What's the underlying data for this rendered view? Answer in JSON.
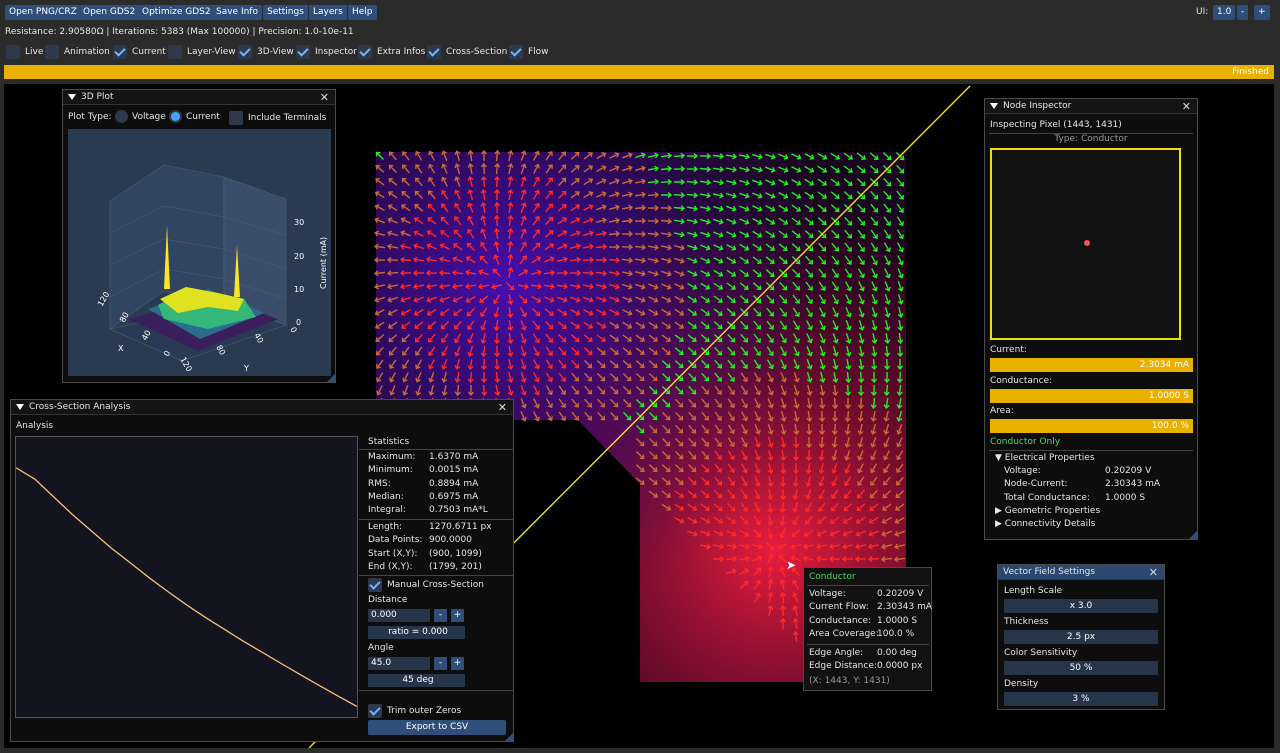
{
  "toolbar": {
    "buttons": [
      "Open PNG/CRZ",
      "Open GDS2",
      "Optimize GDS2",
      "Save Info",
      "Settings",
      "Layers",
      "Help"
    ],
    "ui_label": "UI:",
    "ui_scale": "1.0",
    "minus": "-",
    "plus": "+"
  },
  "status_line": "Resistance: 2.90580Ω | Iterations: 5383 (Max 100000) | Precision: 1.0-10e-11",
  "toggles": [
    {
      "label": "Live",
      "checked": false
    },
    {
      "label": "Animation",
      "checked": false
    },
    {
      "label": "Current",
      "checked": true
    },
    {
      "label": "Layer-View",
      "checked": false
    },
    {
      "label": "3D-View",
      "checked": true
    },
    {
      "label": "Inspector",
      "checked": true
    },
    {
      "label": "Extra Infos",
      "checked": true
    },
    {
      "label": "Cross-Section",
      "checked": true
    },
    {
      "label": "Flow",
      "checked": true
    }
  ],
  "progress": {
    "label": "Finished",
    "fraction": 1.0,
    "color": "#e8b000"
  },
  "plot3d": {
    "title": "3D Plot",
    "plot_type_label": "Plot Type:",
    "options": [
      {
        "label": "Voltage",
        "selected": false
      },
      {
        "label": "Current",
        "selected": true
      }
    ],
    "include_terminals": "Include Terminals",
    "z_ticks": [
      "30",
      "20",
      "10",
      "0"
    ],
    "z_label": "Current (mA)",
    "x_ticks": [
      "120",
      "80",
      "40",
      "0"
    ],
    "x_label": "X",
    "y_ticks": [
      "0",
      "40",
      "80",
      "120"
    ],
    "y_label": "Y"
  },
  "cross": {
    "title": "Cross-Section Analysis",
    "section": "Analysis",
    "stats_title": "Statistics",
    "stats": [
      [
        "Maximum:",
        "1.6370 mA"
      ],
      [
        "Minimum:",
        "0.0015 mA"
      ],
      [
        "RMS:",
        "0.8894 mA"
      ],
      [
        "Median:",
        "0.6975 mA"
      ],
      [
        "Integral:",
        "0.7503 mA*L"
      ]
    ],
    "geo": [
      [
        "Length:",
        "1270.6711 px"
      ],
      [
        "Data Points:",
        "900.0000"
      ],
      [
        "Start (X,Y):",
        "(900, 1099)"
      ],
      [
        "End (X,Y):",
        "(1799, 201)"
      ]
    ],
    "manual": "Manual Cross-Section",
    "distance_label": "Distance",
    "distance": "0.000",
    "ratio": "ratio = 0.000",
    "angle_label": "Angle",
    "angle": "45.0",
    "angle_deg": "45 deg",
    "trim": "Trim outer Zeros",
    "export": "Export to CSV",
    "minus": "-",
    "plus": "+",
    "curve": [
      1.637,
      1.56,
      1.44,
      1.32,
      1.21,
      1.1,
      1.0,
      0.9,
      0.805,
      0.715,
      0.63,
      0.55,
      0.47,
      0.395,
      0.32,
      0.245,
      0.172,
      0.1,
      0.03
    ]
  },
  "inspector": {
    "title": "Node Inspector",
    "pixel": "Inspecting Pixel (1443, 1431)",
    "type": "Type: Conductor",
    "current_label": "Current:",
    "current": "2.3034 mA",
    "conductance_label": "Conductance:",
    "conductance": "1.0000 S",
    "area_label": "Area:",
    "area": "100.0 %",
    "conductor_only": "Conductor Only",
    "electrical": "Electrical Properties",
    "props": [
      [
        "Voltage:",
        "0.20209 V"
      ],
      [
        "Node-Current:",
        "2.30343 mA"
      ],
      [
        "Total Conductance:",
        "1.0000 S"
      ]
    ],
    "geometric": "Geometric Properties",
    "connectivity": "Connectivity Details"
  },
  "tooltip": {
    "title": "Conductor",
    "rows": [
      [
        "Voltage:",
        "0.20209 V"
      ],
      [
        "Current Flow:",
        "2.30343 mA"
      ],
      [
        "Conductance:",
        "1.0000 S"
      ],
      [
        "Area Coverage:",
        "100.0 %"
      ]
    ],
    "rows2": [
      [
        "Edge Angle:",
        "0.00 deg"
      ],
      [
        "Edge Distance:",
        "0.0000 px"
      ]
    ],
    "coords": "(X: 1443, Y: 1431)"
  },
  "vector": {
    "title": "Vector Field Settings",
    "items": [
      [
        "Length Scale",
        "x 3.0"
      ],
      [
        "Thickness",
        "2.5 px"
      ],
      [
        "Color Sensitivity",
        "50 %"
      ],
      [
        "Density",
        "3 %"
      ]
    ]
  },
  "colors": {
    "accent": "#e8b000",
    "button": "#2f4f7a",
    "arrow_far": "#22ee22",
    "arrow_near": "#ff1a1a",
    "source": "#5a1aff",
    "cross_line": "#f0e020"
  }
}
